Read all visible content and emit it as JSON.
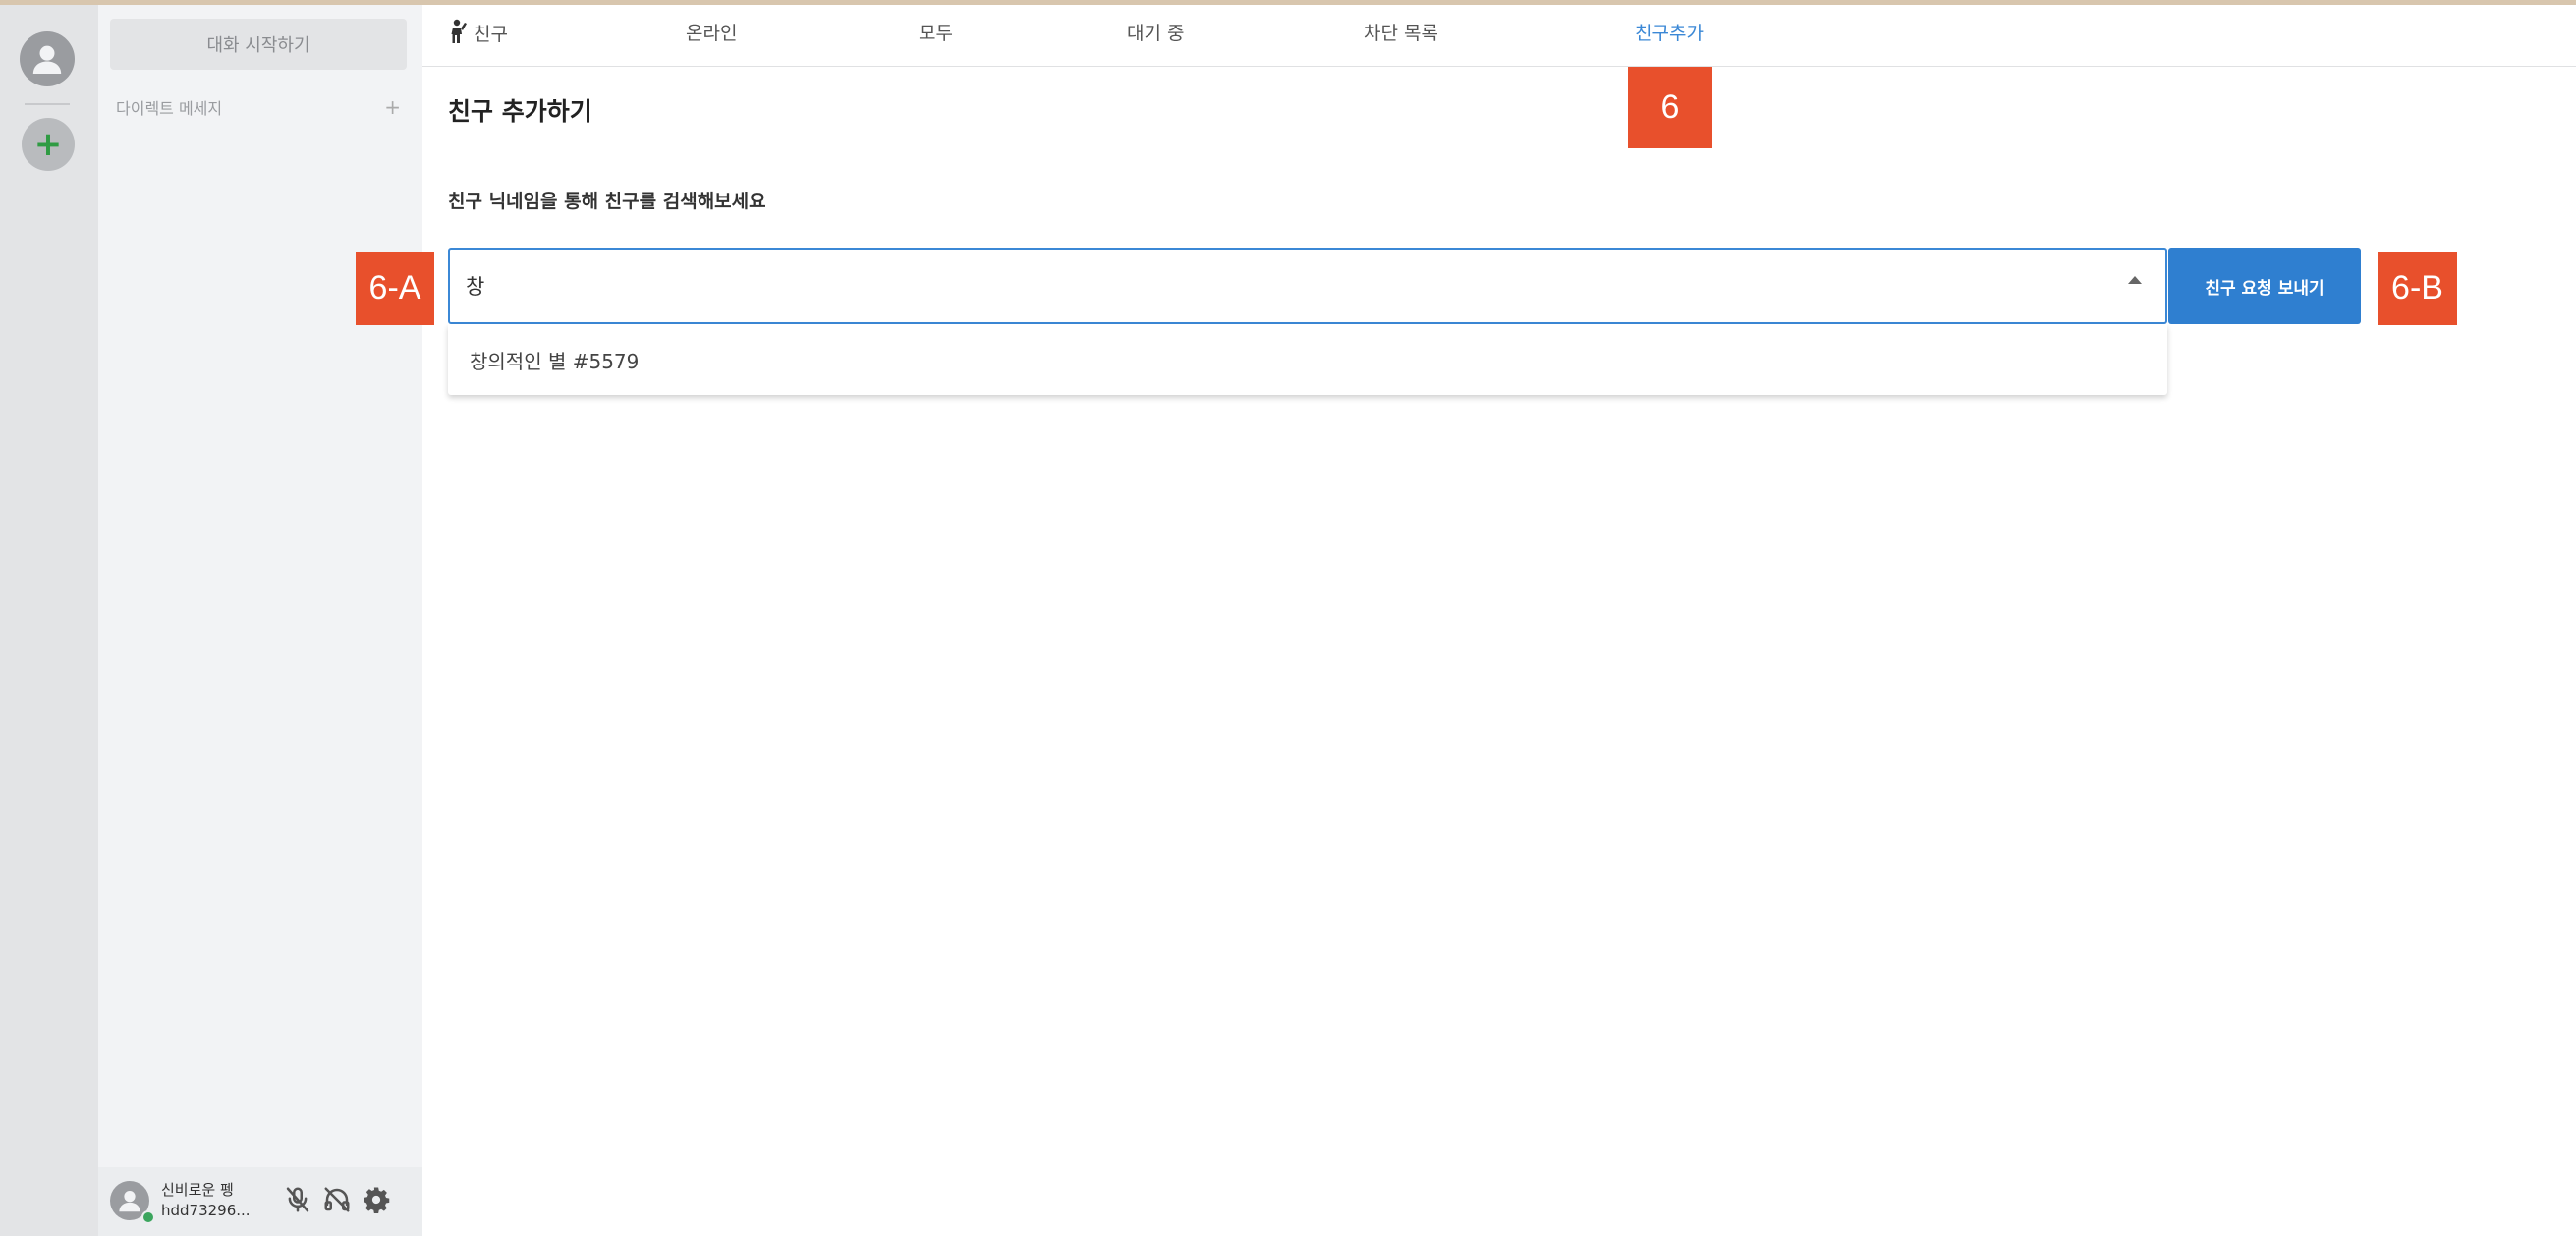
{
  "sidebar": {
    "start_chat": "대화 시작하기",
    "direct_messages": "다이렉트 메세지",
    "dm_add": "+"
  },
  "user": {
    "name": "신비로운 펭",
    "tag": "hdd73296..."
  },
  "tabs": [
    {
      "label": "친구",
      "icon": "waving-person-icon"
    },
    {
      "label": "온라인"
    },
    {
      "label": "모두"
    },
    {
      "label": "대기 중"
    },
    {
      "label": "차단 목록"
    },
    {
      "label": "친구추가",
      "active": true
    }
  ],
  "main": {
    "heading": "친구 추가하기",
    "description": "친구 닉네임을 통해 친구를 검색해보세요",
    "search_value": "창",
    "suggestion": "창의적인 별 #5579",
    "send_button": "친구 요청 보내기"
  },
  "annotations": {
    "tab_badge": "6",
    "input_badge": "6-A",
    "button_badge": "6-B"
  },
  "colors": {
    "accent": "#3b88d6",
    "button": "#2f7fd0",
    "badge": "#e8502c",
    "online": "#3ba55d"
  }
}
